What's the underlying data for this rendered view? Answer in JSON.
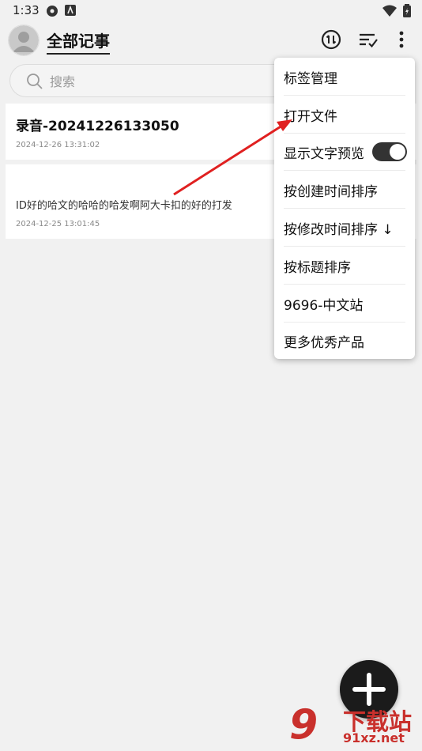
{
  "status_bar": {
    "time": "1:33"
  },
  "header": {
    "title": "全部记事"
  },
  "search": {
    "placeholder": "搜索"
  },
  "notes": [
    {
      "title": "录音-20241226133050",
      "body": "",
      "date": "2024-12-26 13:31:02"
    },
    {
      "title": "",
      "body": "ID好的哈文的哈哈的哈发啊阿大卡扣的好的打发",
      "date": "2024-12-25 13:01:45"
    }
  ],
  "menu": {
    "items": [
      {
        "label": "标签管理"
      },
      {
        "label": "打开文件"
      },
      {
        "label": "显示文字预览",
        "toggle": true,
        "toggle_on": true
      },
      {
        "label": "按创建时间排序"
      },
      {
        "label": "按修改时间排序 ↓"
      },
      {
        "label": "按标题排序"
      },
      {
        "label": "9696-中文站"
      },
      {
        "label": "更多优秀产品"
      }
    ]
  },
  "watermark": {
    "logo": "9",
    "text": "下载站",
    "url": "91xz.net"
  },
  "colors": {
    "background": "#f1f1f1",
    "accent_dark": "#1b1b1b",
    "annotation_arrow": "#e02020",
    "watermark": "#c9302c"
  }
}
